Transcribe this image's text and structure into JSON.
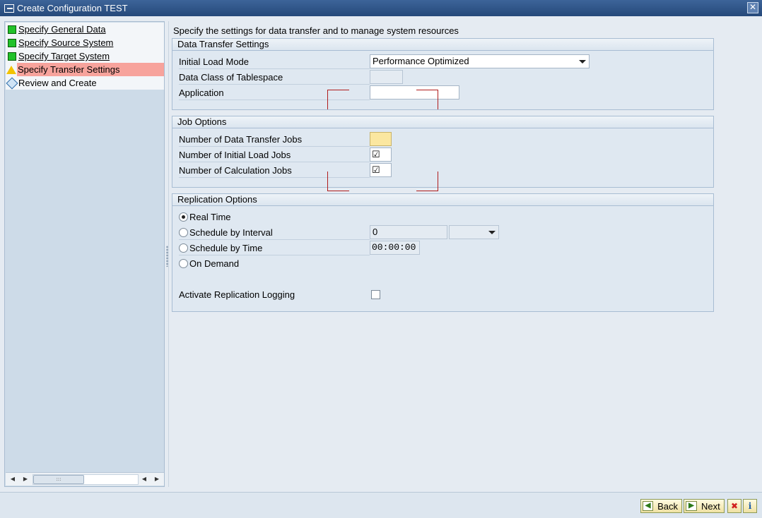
{
  "window": {
    "title": "Create Configuration TEST",
    "close_glyph": "✕"
  },
  "steps": [
    {
      "label": "Specify General Data",
      "status": "done"
    },
    {
      "label": "Specify Source System",
      "status": "done"
    },
    {
      "label": "Specify Target System",
      "status": "done"
    },
    {
      "label": "Specify Transfer Settings",
      "status": "current"
    },
    {
      "label": "Review and Create",
      "status": "pending"
    }
  ],
  "scrollbar": {
    "left_arrow": "◀",
    "right_arrow": "▶",
    "thumb_grip": ":::"
  },
  "intro_text": "Specify the settings for data transfer and to manage system resources",
  "data_transfer": {
    "title": "Data Transfer Settings",
    "initial_load_mode_label": "Initial Load Mode",
    "initial_load_mode_value": "Performance Optimized",
    "data_class_label": "Data Class of Tablespace",
    "data_class_value": "",
    "application_label": "Application",
    "application_value": ""
  },
  "job_options": {
    "title": "Job Options",
    "data_transfer_jobs_label": "Number of Data Transfer Jobs",
    "data_transfer_jobs_value": "",
    "initial_load_jobs_label": "Number of Initial Load Jobs",
    "initial_load_jobs_mark": "☑",
    "calculation_jobs_label": "Number of Calculation Jobs",
    "calculation_jobs_mark": "☑"
  },
  "replication": {
    "title": "Replication Options",
    "real_time_label": "Real Time",
    "interval_label": "Schedule by Interval",
    "interval_value": "0",
    "interval_unit": "",
    "time_label": "Schedule by Time",
    "time_value": "00:00:00",
    "on_demand_label": "On Demand",
    "selected": "Real Time",
    "logging_label": "Activate Replication Logging",
    "logging_checked": false
  },
  "footer": {
    "back_label": "Back",
    "next_label": "Next",
    "cancel_glyph": "✖",
    "info_glyph": "i"
  },
  "colors": {
    "current_step_bg": "#f7a39c",
    "required_field": "#fbe7a0",
    "bracket": "#b01c1c",
    "titlebar": "#26497a"
  }
}
